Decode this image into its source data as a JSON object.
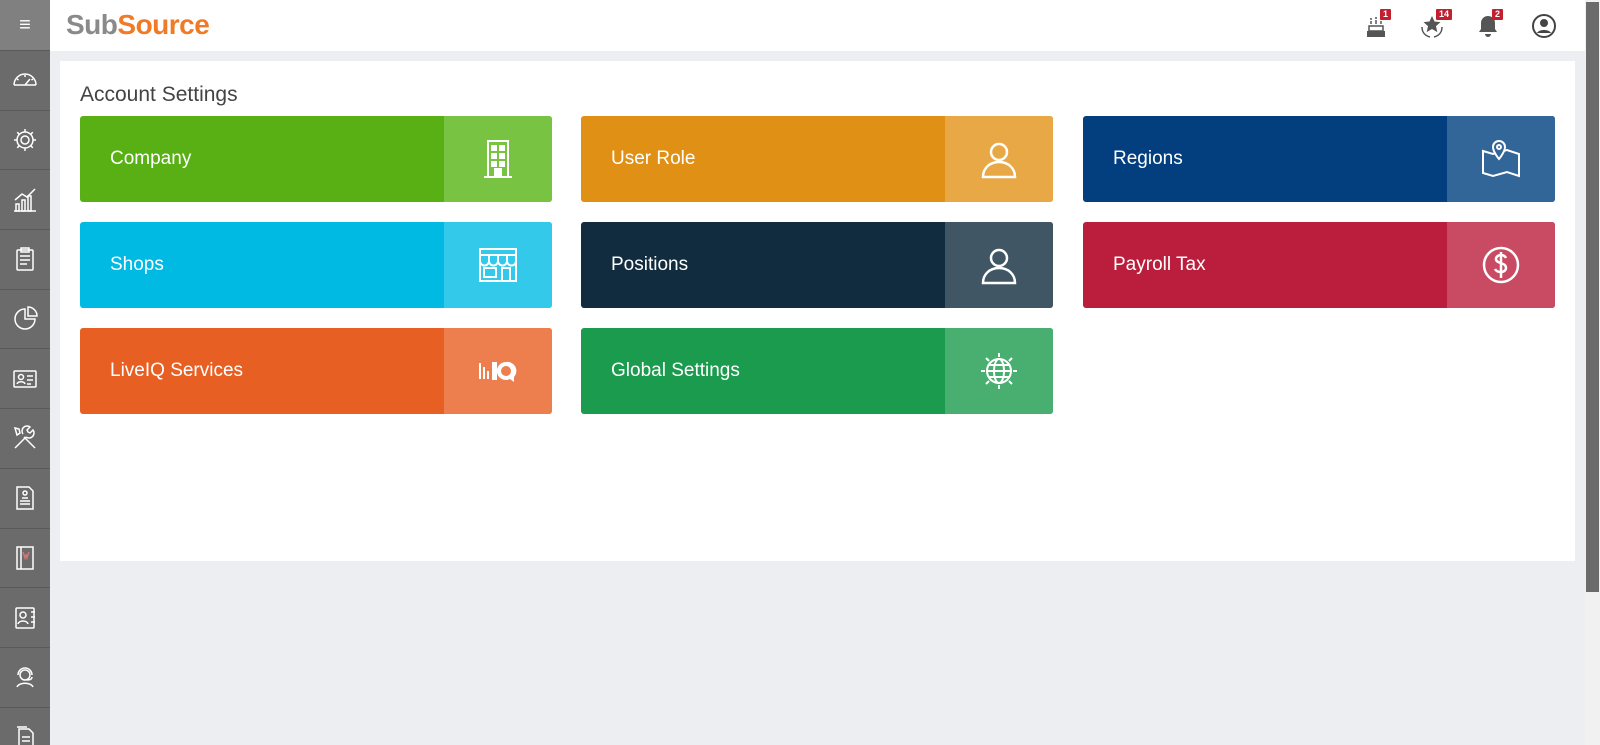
{
  "header": {
    "logo_sub": "Sub",
    "logo_source": "Source",
    "notifications": [
      {
        "icon": "cake-icon",
        "badge": "1"
      },
      {
        "icon": "award-star-icon",
        "badge": "14"
      },
      {
        "icon": "bell-icon",
        "badge": "2"
      },
      {
        "icon": "user-account-icon",
        "badge": ""
      }
    ]
  },
  "sidebar": {
    "menu_label": "≡",
    "items": [
      {
        "icon": "dashboard-icon"
      },
      {
        "icon": "settings-icon"
      },
      {
        "icon": "analytics-icon"
      },
      {
        "icon": "clipboard-icon"
      },
      {
        "icon": "pie-chart-icon"
      },
      {
        "icon": "id-card-icon"
      },
      {
        "icon": "tools-icon"
      },
      {
        "icon": "document-icon"
      },
      {
        "icon": "book-icon"
      },
      {
        "icon": "contacts-icon"
      },
      {
        "icon": "support-agent-icon"
      },
      {
        "icon": "files-icon"
      }
    ]
  },
  "main": {
    "title": "Account Settings",
    "tiles": [
      {
        "label": "Company",
        "icon": "building-icon",
        "color": "#58b014",
        "icon_bg": "#79c342"
      },
      {
        "label": "User Role",
        "icon": "user-icon",
        "color": "#e09015",
        "icon_bg": "#e8a846"
      },
      {
        "label": "Regions",
        "icon": "map-pin-icon",
        "color": "#033f7e",
        "icon_bg": "#336698"
      },
      {
        "label": "Shops",
        "icon": "storefront-icon",
        "color": "#00bae3",
        "icon_bg": "#33c9ea"
      },
      {
        "label": "Positions",
        "icon": "user-icon",
        "color": "#112c3e",
        "icon_bg": "#415665"
      },
      {
        "label": "Payroll Tax",
        "icon": "dollar-icon",
        "color": "#bb1e3c",
        "icon_bg": "#c94b63"
      },
      {
        "label": "LiveIQ Services",
        "icon": "liveiq-icon",
        "color": "#e85f23",
        "icon_bg": "#ed7f4f"
      },
      {
        "label": "Global Settings",
        "icon": "globe-gear-icon",
        "color": "#1b9b4d",
        "icon_bg": "#48af71"
      }
    ]
  }
}
